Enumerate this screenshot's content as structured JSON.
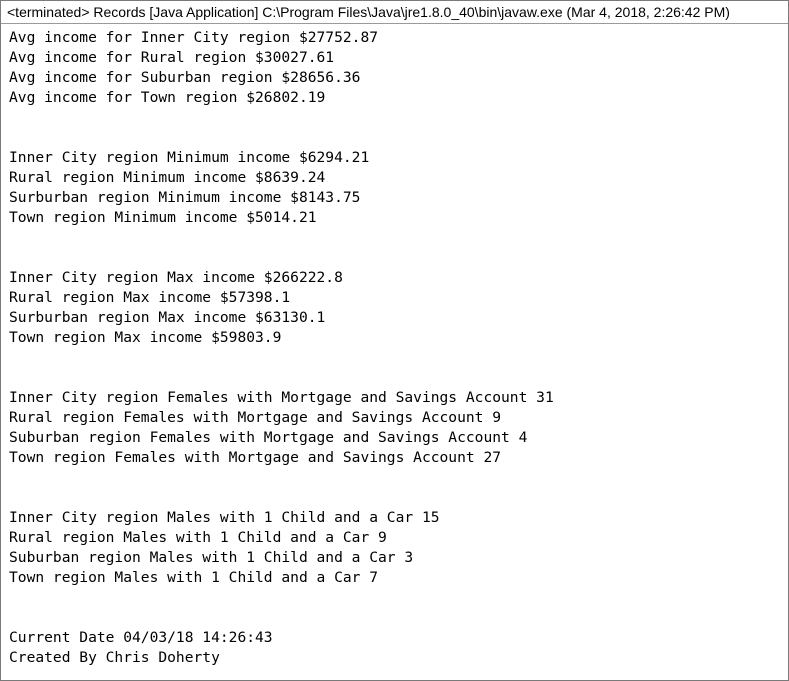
{
  "console": {
    "header": "<terminated> Records [Java Application] C:\\Program Files\\Java\\jre1.8.0_40\\bin\\javaw.exe (Mar 4, 2018, 2:26:42 PM)",
    "lines": [
      "Avg income for Inner City region $27752.87",
      "Avg income for Rural region $30027.61",
      "Avg income for Suburban region $28656.36",
      "Avg income for Town region $26802.19",
      "",
      "",
      "Inner City region Minimum income $6294.21",
      "Rural region Minimum income $8639.24",
      "Surburban region Minimum income $8143.75",
      "Town region Minimum income $5014.21",
      "",
      "",
      "Inner City region Max income $266222.8",
      "Rural region Max income $57398.1",
      "Surburban region Max income $63130.1",
      "Town region Max income $59803.9",
      "",
      "",
      "Inner City region Females with Mortgage and Savings Account 31",
      "Rural region Females with Mortgage and Savings Account 9",
      "Suburban region Females with Mortgage and Savings Account 4",
      "Town region Females with Mortgage and Savings Account 27",
      "",
      "",
      "Inner City region Males with 1 Child and a Car 15",
      "Rural region Males with 1 Child and a Car 9",
      "Suburban region Males with 1 Child and a Car 3",
      "Town region Males with 1 Child and a Car 7",
      "",
      "",
      "Current Date 04/03/18 14:26:43",
      "Created By Chris Doherty"
    ]
  }
}
